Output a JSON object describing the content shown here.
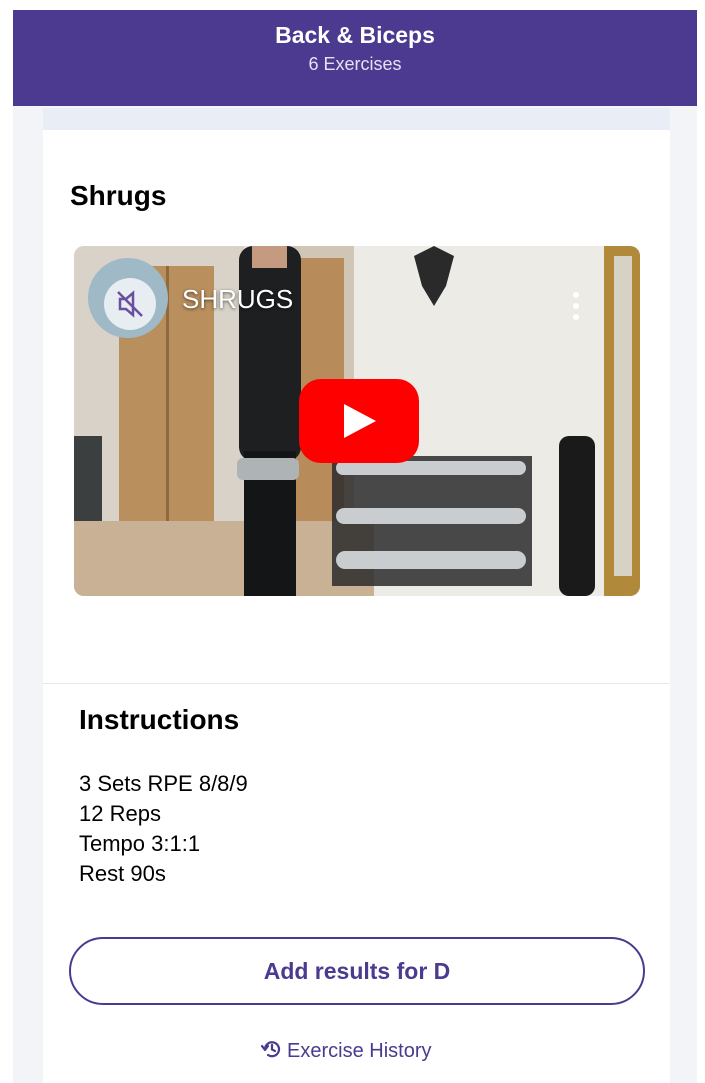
{
  "header": {
    "title": "Back & Biceps",
    "subtitle": "6 Exercises"
  },
  "exercise": {
    "title": "Shrugs"
  },
  "video": {
    "title": "SHRUGS",
    "play_icon": "play-icon",
    "mute_icon": "mute-icon",
    "more_icon": "more-vertical-icon"
  },
  "instructions": {
    "heading": "Instructions",
    "lines": [
      "3 Sets RPE 8/8/9",
      "12 Reps",
      "Tempo 3:1:1",
      "Rest 90s"
    ]
  },
  "actions": {
    "add_results_label": "Add results for D",
    "history_label": "Exercise History",
    "history_icon": "history-icon"
  },
  "colors": {
    "brand": "#4b3a8f",
    "play": "#ff0000"
  }
}
